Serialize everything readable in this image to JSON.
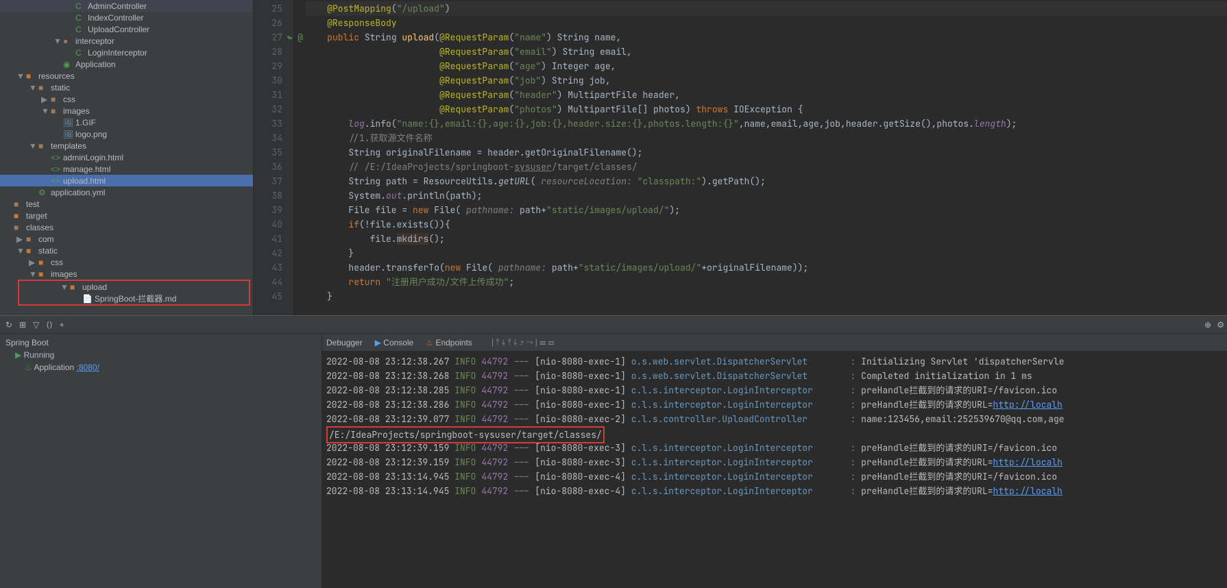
{
  "sidebar": {
    "items": [
      {
        "indent": 90,
        "arrow": "",
        "icon": "C",
        "iconClass": "icon-class",
        "label": "AdminController"
      },
      {
        "indent": 90,
        "arrow": "",
        "icon": "C",
        "iconClass": "icon-class",
        "label": "IndexController"
      },
      {
        "indent": 90,
        "arrow": "",
        "icon": "C",
        "iconClass": "icon-class",
        "label": "UploadController"
      },
      {
        "indent": 72,
        "arrow": "▼",
        "icon": "●",
        "iconClass": "icon-folder",
        "label": "interceptor"
      },
      {
        "indent": 90,
        "arrow": "",
        "icon": "C",
        "iconClass": "icon-class",
        "label": "LoginInterceptor"
      },
      {
        "indent": 72,
        "arrow": "",
        "icon": "◉",
        "iconClass": "icon-class",
        "label": "Application"
      },
      {
        "indent": 18,
        "arrow": "▼",
        "icon": "■",
        "iconClass": "icon-orange",
        "label": "resources"
      },
      {
        "indent": 36,
        "arrow": "▼",
        "icon": "■",
        "iconClass": "icon-folder",
        "label": "static"
      },
      {
        "indent": 54,
        "arrow": "▶",
        "icon": "■",
        "iconClass": "icon-folder",
        "label": "css"
      },
      {
        "indent": 54,
        "arrow": "▼",
        "icon": "■",
        "iconClass": "icon-folder",
        "label": "images"
      },
      {
        "indent": 72,
        "arrow": "",
        "icon": "🖼",
        "iconClass": "icon-file",
        "label": "1.GIF"
      },
      {
        "indent": 72,
        "arrow": "",
        "icon": "🖼",
        "iconClass": "icon-file",
        "label": "logo.png"
      },
      {
        "indent": 36,
        "arrow": "▼",
        "icon": "■",
        "iconClass": "icon-folder",
        "label": "templates"
      },
      {
        "indent": 54,
        "arrow": "",
        "icon": "<>",
        "iconClass": "icon-html",
        "label": "adminLogin.html"
      },
      {
        "indent": 54,
        "arrow": "",
        "icon": "<>",
        "iconClass": "icon-html",
        "label": "manage.html"
      },
      {
        "indent": 54,
        "arrow": "",
        "icon": "<>",
        "iconClass": "icon-html",
        "label": "upload.html",
        "selected": true
      },
      {
        "indent": 36,
        "arrow": "",
        "icon": "⚙",
        "iconClass": "icon-html",
        "label": "application.yml"
      },
      {
        "indent": 0,
        "arrow": "",
        "icon": "■",
        "iconClass": "icon-folder",
        "label": "test"
      },
      {
        "indent": 0,
        "arrow": "",
        "icon": "■",
        "iconClass": "icon-orange",
        "label": "target",
        "labelClass": "t-orange"
      },
      {
        "indent": 0,
        "arrow": "",
        "icon": "■",
        "iconClass": "icon-folder",
        "label": "classes"
      },
      {
        "indent": 18,
        "arrow": "▶",
        "icon": "■",
        "iconClass": "icon-folder",
        "label": "com"
      },
      {
        "indent": 18,
        "arrow": "▼",
        "icon": "■",
        "iconClass": "icon-orange",
        "label": "static"
      },
      {
        "indent": 36,
        "arrow": "▶",
        "icon": "■",
        "iconClass": "icon-orange",
        "label": "css"
      },
      {
        "indent": 36,
        "arrow": "▼",
        "icon": "■",
        "iconClass": "icon-orange",
        "label": "images"
      },
      {
        "indent": 54,
        "arrow": "▼",
        "icon": "■",
        "iconClass": "icon-orange",
        "label": "upload",
        "redbox": "start"
      },
      {
        "indent": 72,
        "arrow": "",
        "icon": "📄",
        "iconClass": "icon-md",
        "label": "SpringBoot-拦截器.md",
        "redbox": "end"
      }
    ]
  },
  "editor": {
    "startLine": 25,
    "lines": [
      {
        "n": 25,
        "hl": true,
        "html": "    <span class='t-annotation'>@PostMapping</span>(<span class='t-string'>\"/upload\"</span>)"
      },
      {
        "n": 26,
        "html": "    <span class='t-annotation'>@ResponseBody</span>"
      },
      {
        "n": 27,
        "ann": "↬ @",
        "html": "    <span class='t-keyword'>public</span> String <span class='t-method'>upload</span>(<span class='t-annotation'>@RequestParam</span>(<span class='t-string'>\"name\"</span>) String name,"
      },
      {
        "n": 28,
        "html": "                         <span class='t-annotation'>@RequestParam</span>(<span class='t-string'>\"email\"</span>) String email,"
      },
      {
        "n": 29,
        "html": "                         <span class='t-annotation'>@RequestParam</span>(<span class='t-string'>\"age\"</span>) Integer age,"
      },
      {
        "n": 30,
        "html": "                         <span class='t-annotation'>@RequestParam</span>(<span class='t-string'>\"job\"</span>) String job,"
      },
      {
        "n": 31,
        "html": "                         <span class='t-annotation'>@RequestParam</span>(<span class='t-string'>\"header\"</span>) MultipartFile header,"
      },
      {
        "n": 32,
        "html": "                         <span class='t-annotation'>@RequestParam</span>(<span class='t-string'>\"photos\"</span>) MultipartFile[] photos) <span class='t-keyword'>throws</span> IOException {"
      },
      {
        "n": 33,
        "html": "        <span class='t-static'>log</span>.info(<span class='t-string'>\"name:{},email:{},age:{},job:{},header.size:{},photos.length:{}\"</span>,name,email,age,job,header.getSize(),photos.<span class='t-static'>length</span>);"
      },
      {
        "n": 34,
        "html": "        <span class='t-comment'>//1.获取源文件名称</span>"
      },
      {
        "n": 35,
        "html": "        String originalFilename = header.getOriginalFilename();"
      },
      {
        "n": 36,
        "html": "        <span class='t-comment'>// /E:/IdeaProjects/springboot-<u>sysuser</u>/target/classes/</span>"
      },
      {
        "n": 37,
        "html": "        String path = ResourceUtils.<span class='t-italic'>getURL</span>( <span class='t-param'>resourceLocation:</span> <span class='t-string'>\"classpath:\"</span>).getPath();"
      },
      {
        "n": 38,
        "html": "        System.<span class='t-static'>out</span>.println(path);"
      },
      {
        "n": 39,
        "html": "        File file = <span class='t-keyword'>new</span> File( <span class='t-param'>pathname:</span> path+<span class='t-string'>\"static/images/upload/\"</span>);"
      },
      {
        "n": 40,
        "html": "        <span class='t-keyword'>if</span>(!file.exists()){"
      },
      {
        "n": 41,
        "html": "            file.<span style='background:#40332b'>mkdirs</span>();"
      },
      {
        "n": 42,
        "html": "        }"
      },
      {
        "n": 43,
        "html": "        header.transferTo(<span class='t-keyword'>new</span> File( <span class='t-param'>pathname:</span> path+<span class='t-string'>\"static/images/upload/\"</span>+originalFilename));"
      },
      {
        "n": 44,
        "html": "        <span class='t-keyword'>return</span> <span class='t-string'>\"注册用户成功/文件上传成功\"</span>;"
      },
      {
        "n": 45,
        "html": "    }"
      }
    ]
  },
  "debug": {
    "title": "Spring Boot",
    "running": "Running",
    "app": "Application",
    "port": ":8080/",
    "tabs": {
      "debugger": "Debugger",
      "console": "Console",
      "endpoints": "Endpoints"
    }
  },
  "console": {
    "lines": [
      {
        "ts": "2022-08-08 23:12:38.267",
        "lvl": "INFO",
        "pid": "44792",
        "th": "[nio-8080-exec-1]",
        "lg": "o.s.web.servlet.DispatcherServlet",
        "msg": "Initializing Servlet 'dispatcherServle"
      },
      {
        "ts": "2022-08-08 23:12:38.268",
        "lvl": "INFO",
        "pid": "44792",
        "th": "[nio-8080-exec-1]",
        "lg": "o.s.web.servlet.DispatcherServlet",
        "msg": "Completed initialization in 1 ms"
      },
      {
        "ts": "2022-08-08 23:12:38.285",
        "lvl": "INFO",
        "pid": "44792",
        "th": "[nio-8080-exec-1]",
        "lg": "c.l.s.interceptor.LoginInterceptor",
        "msg": "preHandle拦截到的请求的URI=/favicon.ico"
      },
      {
        "ts": "2022-08-08 23:12:38.286",
        "lvl": "INFO",
        "pid": "44792",
        "th": "[nio-8080-exec-1]",
        "lg": "c.l.s.interceptor.LoginInterceptor",
        "msg": "preHandle拦截到的请求的URL=",
        "url": "http://localh"
      },
      {
        "ts": "2022-08-08 23:12:39.077",
        "lvl": "INFO",
        "pid": "44792",
        "th": "[nio-8080-exec-2]",
        "lg": "c.l.s.controller.UploadController",
        "msg": "name:123456,email:252539670@qq.com,age"
      },
      {
        "path": "/E:/IdeaProjects/springboot-sysuser/target/classes/",
        "hl": true
      },
      {
        "ts": "2022-08-08 23:12:39.159",
        "lvl": "INFO",
        "pid": "44792",
        "th": "[nio-8080-exec-3]",
        "lg": "c.l.s.interceptor.LoginInterceptor",
        "msg": "preHandle拦截到的请求的URI=/favicon.ico"
      },
      {
        "ts": "2022-08-08 23:12:39.159",
        "lvl": "INFO",
        "pid": "44792",
        "th": "[nio-8080-exec-3]",
        "lg": "c.l.s.interceptor.LoginInterceptor",
        "msg": "preHandle拦截到的请求的URL=",
        "url": "http://localh"
      },
      {
        "ts": "2022-08-08 23:13:14.945",
        "lvl": "INFO",
        "pid": "44792",
        "th": "[nio-8080-exec-4]",
        "lg": "c.l.s.interceptor.LoginInterceptor",
        "msg": "preHandle拦截到的请求的URI=/favicon.ico"
      },
      {
        "ts": "2022-08-08 23:13:14.945",
        "lvl": "INFO",
        "pid": "44792",
        "th": "[nio-8080-exec-4]",
        "lg": "c.l.s.interceptor.LoginInterceptor",
        "msg": "preHandle拦截到的请求的URL=",
        "url": "http://localh"
      }
    ]
  }
}
